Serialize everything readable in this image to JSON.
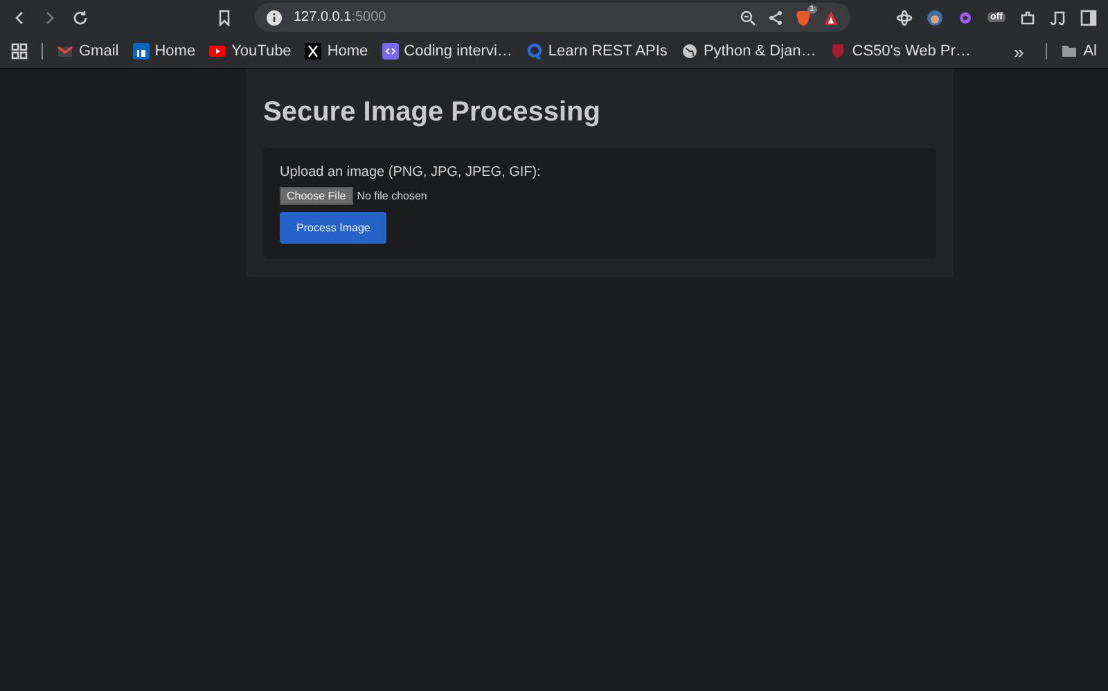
{
  "browser": {
    "url_host": "127.0.0.1",
    "url_port": ":5000",
    "shield_count": "1",
    "extension_badge": "off",
    "bookmarks": [
      {
        "label": "Gmail",
        "kind": "mail"
      },
      {
        "label": "Home",
        "kind": "linkedin"
      },
      {
        "label": "YouTube",
        "kind": "youtube"
      },
      {
        "label": "Home",
        "kind": "x"
      },
      {
        "label": "Coding intervi…",
        "kind": "code"
      },
      {
        "label": "Learn REST APIs",
        "kind": "q"
      },
      {
        "label": "Python & Djan…",
        "kind": "globe"
      },
      {
        "label": "CS50's Web Pr…",
        "kind": "shield"
      }
    ],
    "more": "»",
    "folder": "Al"
  },
  "page": {
    "title": "Secure Image Processing",
    "upload_label": "Upload an image (PNG, JPG, JPEG, GIF):",
    "choose_file": "Choose File",
    "no_file": "No file chosen",
    "submit": "Process Image"
  }
}
